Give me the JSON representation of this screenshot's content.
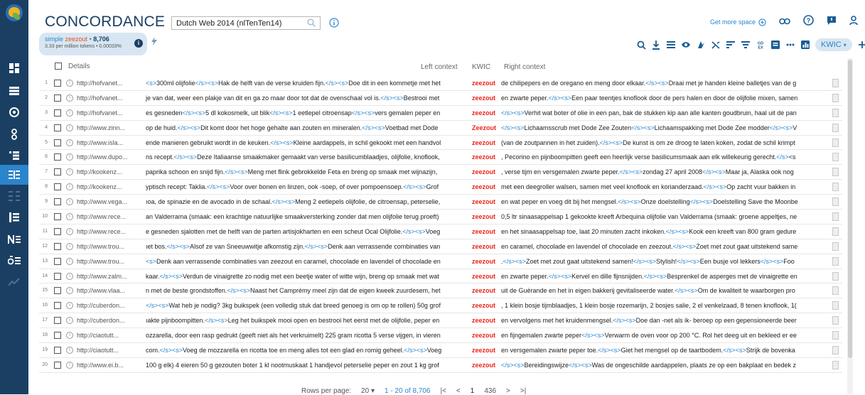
{
  "app": {
    "title": "CONCORDANCE"
  },
  "corpus": {
    "value": "Dutch Web 2014 (nlTenTen14)"
  },
  "topbar": {
    "get_more_space": "Get more space"
  },
  "query": {
    "type_label": "simple",
    "term": "zeezout",
    "hits": "8,706",
    "freq_line": "3.33 per million tokens • 0.00033%"
  },
  "toolbar": {
    "view_mode": "KWIC"
  },
  "table_header": {
    "details": "Details",
    "left_context": "Left context",
    "kwic": "KWIC",
    "right_context": "Right context"
  },
  "rows": [
    {
      "n": "1",
      "url": "http://hofvanet...",
      "left": "<s>300ml olijfolie</s><s>Hak de helft van de verse kruiden fijn.</s><s>Doe dit in een kommetje met het",
      "kwic": "zeezout",
      "right": "de chilipepers en de oregano en meng door elkaar.</s><s>Draai met je handen kleine balletjes van de g"
    },
    {
      "n": "2",
      "url": "http://hofvanet...",
      "left": "je van dat, weer een plakje van dit en ga zo maar door tot dat de ovenschaal vol is.</s><s>Bestrooi met",
      "kwic": "zeezout",
      "right": "en zwarte peper.</s><s>Een paar teentjes knoflook door de pers halen en door de olijfolie mixen, samen"
    },
    {
      "n": "3",
      "url": "http://hofvanet...",
      "left": "es gesneden</s><s>5 dl kokosmelk, uit blik</s><s>1 eetlepel citroensap</s><s>vers gemalen peper en",
      "kwic": "zeezout",
      "right": "</s><s>Verhit wat boter of olie in een pan, bak de stukken kip aan alle kanten goudbruin, haal uit de pan"
    },
    {
      "n": "4",
      "url": "http://www.zinn...",
      "left": "op de huid.</s><s>Dit komt door het hoge gehalte aan zouten en mineralen.</s><s>Voetbad met Dode",
      "kwic": "Zeezout",
      "right": "</s><s>Lichaamsscrub met Dode Zee Zouten</s><s>Lichaamspakking met Dode Zee modder</s><s>V"
    },
    {
      "n": "5",
      "url": "http://www.isla...",
      "left": "ende manieren gebruikt wordt in de keuken.</s><s>Kleine aardappels, in schil gekookt met een handvol",
      "kwic": "zeezout",
      "right": "(van de zoutpannen in het zuiden).</s><s>De kunst is om ze droog te laten koken, zodat de schil krimpt"
    },
    {
      "n": "6",
      "url": "http://www.dupo...",
      "left": "ns recept.</s><s>Deze Italiaanse smaakmaker gemaakt van verse basilicumblaadjes, olijfolie, knoflook,",
      "kwic": "zeezout",
      "right": ", Pecorino en pijnboompitten geeft een heerlijk verse basilicumsmaak aan elk willekeurig gerecht.</s><s"
    },
    {
      "n": "7",
      "url": "http://kookenz...",
      "left": "paprika schoon en snijd fijn.</s><s>Meng met flink gebrokkelde Feta en breng op smaak met wijnazijn,",
      "kwic": "zeezout",
      "right": ", verse tijm en versgemalen zwarte peper.</s><s>zondag 27 april 2008</s><s>Maar ja, Alaska ook nog"
    },
    {
      "n": "8",
      "url": "http://kookenz...",
      "left": "yptisch recept: Taklia.</s><s>Voor over bonen en linzen, ook -soep, of over pompoensoep.</s><s>Grof",
      "kwic": "zeezout",
      "right": "met een deegroller walsen, samen met veel knoflook en korianderzaad.</s><s>Op zacht vuur bakken in"
    },
    {
      "n": "9",
      "url": "http://www.vega...",
      "left": "ıoa, de spinazie en de avocado in de schaal.</s><s>Meng 2 eetlepels olijfolie, de citroensap, peterselie,",
      "kwic": "zeezout",
      "right": "en wat peper en voeg dit bij het mengsel.</s><s>Onze doelstelling</s><s>Doelstelling Save the Moonbe"
    },
    {
      "n": "10",
      "url": "http://www.rece...",
      "left": "an Valderrama (smaak: een krachtige natuurlijke smaakversterking zonder dat men olijfolie terug proeft)",
      "kwic": "zeezout",
      "right": "0,5 ltr sinaasappelsap 1 gekookte kreeft Arbequina olijfolie van Valderrama (smaak: groene appeltjes, ne"
    },
    {
      "n": "11",
      "url": "http://www.rece...",
      "left": "e gesneden sjalotten met de helft van de parten artisjokharten en een scheut Ocal Olijfolie.</s><s>Voeg",
      "kwic": "zeezout",
      "right": "en het sinaasappelsap toe, laat 20 minuten zacht inkoken.</s><s>Kook een kreeft van 800 gram gedure"
    },
    {
      "n": "12",
      "url": "http://www.trou...",
      "left": "ıet bos.</s><s>Alsof ze van Sneeuwwitje afkomstig zijn.</s><s>Denk aan verrassende combinaties van",
      "kwic": "zeezout",
      "right": "en caramel, chocolade en lavendel of chocolade en zeezout.</s><s>Zoet met zout gaat uitstekend same"
    },
    {
      "n": "13",
      "url": "http://www.trou...",
      "left": "<s>Denk aan verrassende combinaties van zeezout en caramel, chocolade en lavendel of chocolade en",
      "kwic": "zeezout",
      "right": ".</s><s>Zoet met zout gaat uitstekend samen!</s><s>Stylish!</s><s>Een busje vol lekkers</s><s>Foo"
    },
    {
      "n": "14",
      "url": "http://www.zalm...",
      "left": "kaar.</s><s>Verdun de vinaigrette zo nodig met een beetje water of witte wijn, breng op smaak met wat",
      "kwic": "zeezout",
      "right": "en zwarte peper.</s><s>Kervel en dille fijnsnijden.</s><s>Besprenkel de asperges met de vinaigrette en"
    },
    {
      "n": "15",
      "url": "http://www.vlaa...",
      "left": "n met de beste grondstoffen.</s><s>Naast het Camprémy meel zijn dat de eigen kweek zuurdesem, het",
      "kwic": "zeezout",
      "right": "uit de Guérande en het in eigen bakkerij gevitaliseerde water.</s><s>Om de kwaliteit te waarborgen pro"
    },
    {
      "n": "16",
      "url": "http://cuberdon...",
      "left": "</s><s>Wat heb je nodig? 3kg buikspek (een volledig stuk dat breed genoeg is om op te rollen) 50g grof",
      "kwic": "zeezout",
      "right": ", 1 klein bosje tijmblaadjes, 1 klein bosje rozemarijn, 2 bosjes salie, 2 el venkelzaad, 8 tenen knoflook, 1("
    },
    {
      "n": "17",
      "url": "http://cuberdon...",
      "left": "ıakte pijnboompitten.</s><s>Leg het buikspek mooi open en bestrooi het eerst met de olijfolie, peper en",
      "kwic": "zeezout",
      "right": "en vervolgens met het kruidenmengsel.</s><s>Doe dan -net als ik- beroep op een gepensioneerde beer"
    },
    {
      "n": "18",
      "url": "http://ciaotutt...",
      "left": "ozzarella, door een rasp gedrukt (geeft niet als het verkruimelt) 225 gram ricotta 5 verse vijgen, in vieren",
      "kwic": "zeezout",
      "right": "en fijngemalen zwarte peper</s><s>Verwarm de oven voor op 200 °C. Rol het deeg uit en bekleed er ee"
    },
    {
      "n": "19",
      "url": "http://ciaotutt...",
      "left": "com.</s><s>Voeg de mozzarella en ricotta toe en meng alles tot een glad en romig geheel.</s><s>Voeg",
      "kwic": "zeezout",
      "right": "en versgemalen zwarte peper toe.</s><s>Giet het mengsel op de taartbodem.</s><s>Strijk de bovenka"
    },
    {
      "n": "20",
      "url": "http://www.ei.b...",
      "left": "100 g elk) 4 eieren 50 g gezouten boter 1 kl nootmuskaat 1 handjevol peterselie peper en zout 1 kg grof",
      "kwic": "zeezout",
      "right": "</s><s>Bereidingswijze</s><s>Was de ongeschilde aardappelen, plaats ze op een bakplaat en bedek z"
    }
  ],
  "pagination": {
    "rows_per_page_label": "Rows per page:",
    "rows_per_page": "20",
    "range": "1 - 20 of 8,706",
    "page": "1",
    "total_pages": "436"
  }
}
